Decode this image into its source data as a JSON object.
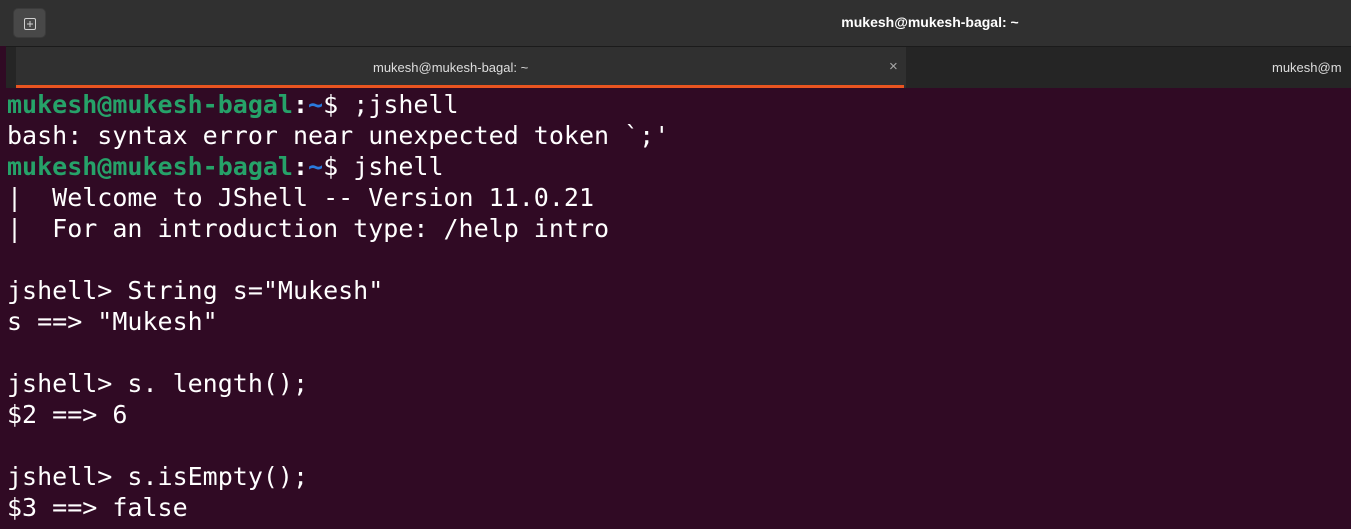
{
  "window": {
    "title": "mukesh@mukesh-bagal: ~"
  },
  "tabs": [
    {
      "label": "mukesh@mukesh-bagal: ~",
      "close": "×"
    },
    {
      "label": "mukesh@m"
    }
  ],
  "prompt": {
    "user": "mukesh@mukesh-bagal",
    "sep": ":",
    "path": "~",
    "sym": "$ "
  },
  "lines": {
    "cmd1": ";jshell",
    "err1": "bash: syntax error near unexpected token `;'",
    "cmd2": "jshell",
    "welcome1": "|  Welcome to JShell -- Version 11.0.21",
    "welcome2": "|  For an introduction type: /help intro",
    "j1": "jshell> String s=\"Mukesh\"",
    "r1": "s ==> \"Mukesh\"",
    "j2": "jshell> s. length();",
    "r2": "$2 ==> 6",
    "j3": "jshell> s.isEmpty();",
    "r3": "$3 ==> false"
  },
  "colors": {
    "background": "#300a24",
    "prompt_user": "#26a269",
    "prompt_path": "#2a7bde",
    "tab_accent": "#e95420"
  }
}
